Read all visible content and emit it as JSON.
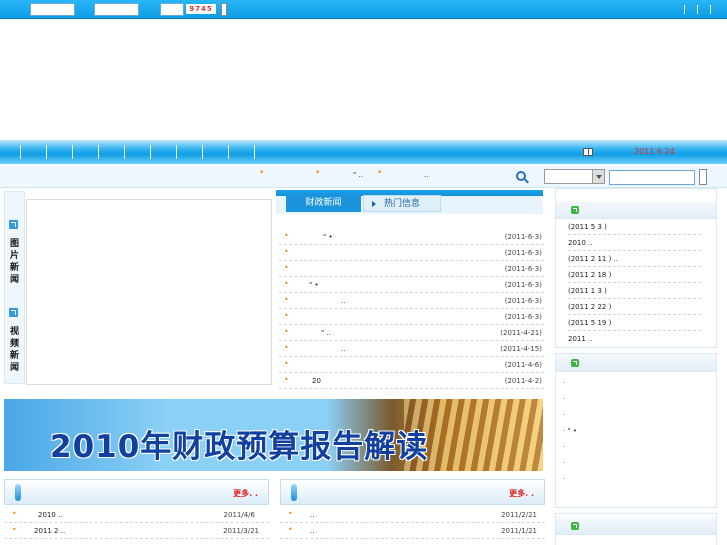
{
  "topbar": {
    "captcha_text": "9745"
  },
  "nav": {
    "date": "2011 6 24"
  },
  "subbar": {
    "item1_suffix": "\"",
    "item1_dots": "..",
    "item2_dots": ".."
  },
  "left_tabs": {
    "pictures": "图片新闻",
    "videos": "视频新闻"
  },
  "news_tabs": {
    "tab1": "财政新闻",
    "tab2": "热门信息"
  },
  "news_items": [
    {
      "title": "\" •",
      "date": "(2011-6-3)"
    },
    {
      "title": "",
      "date": "(2011-6-3)"
    },
    {
      "title": "",
      "date": "(2011-6-3)"
    },
    {
      "title": "\" •",
      "date": "(2011-6-3)"
    },
    {
      "title": "..",
      "date": "(2011-6-3)"
    },
    {
      "title": "",
      "date": "(2011-6-3)"
    },
    {
      "title": "\"  ..",
      "date": "(2011-4-21)"
    },
    {
      "title": "..",
      "date": "(2011-4-15)"
    },
    {
      "title": "",
      "date": "(2011-4-6)"
    },
    {
      "title": "20",
      "date": "(2011-4-2)"
    }
  ],
  "right_list": [
    "(2011 5 3 )",
    "2010        ..",
    "(2011 2 11 )    ..",
    "(2011 2 18 )",
    "(2011 1 3 )",
    "(2011 2 22 )",
    "(2011 5 19 )",
    "   2011       .."
  ],
  "right_list2": [
    "·",
    "·",
    "·",
    "·  \" •",
    "·",
    "·",
    "·"
  ],
  "banner": {
    "budget_title": "2010年财政预算报告解读"
  },
  "bottom": {
    "more": "更多. .",
    "left_items": [
      {
        "title": "2010        ..",
        "date": "2011/4/6"
      },
      {
        "title": "2011 2      ..",
        "date": "2011/3/21"
      }
    ],
    "right_items": [
      {
        "title": "            ..",
        "date": "2011/2/21"
      },
      {
        "title": "            ..",
        "date": "2011/1/21"
      }
    ]
  }
}
